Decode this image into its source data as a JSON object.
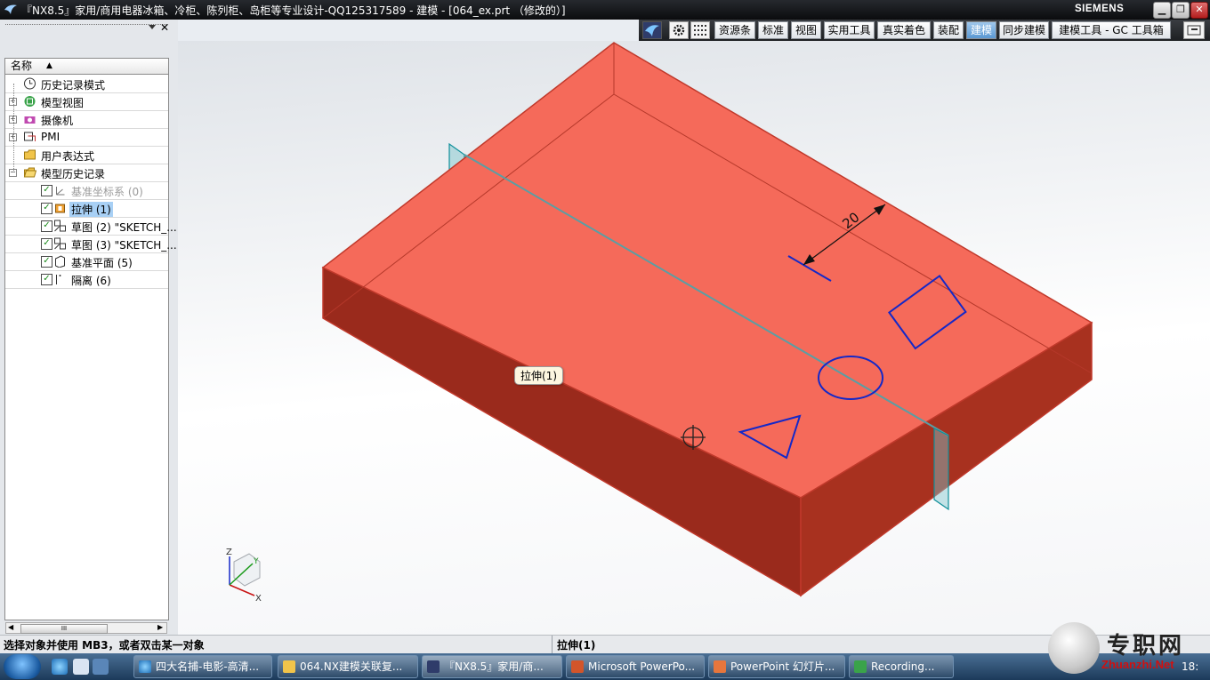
{
  "window": {
    "title": "『NX8.5』家用/商用电器冰箱、冷柜、陈列柜、岛柜等专业设计-QQ125317589 - 建模 - [064_ex.prt （修改的）]",
    "brand": "SIEMENS",
    "controls": {
      "minimize": "▁",
      "restore": "❐",
      "close": "✕"
    }
  },
  "toolbar": {
    "tabs": [
      {
        "label": "资源条",
        "active": false
      },
      {
        "label": "标准",
        "active": false
      },
      {
        "label": "视图",
        "active": false
      },
      {
        "label": "实用工具",
        "active": false
      },
      {
        "label": "真实着色",
        "active": false
      },
      {
        "label": "装配",
        "active": false
      },
      {
        "label": "建模",
        "active": true
      },
      {
        "label": "同步建模",
        "active": false
      },
      {
        "label": "建模工具 - GC 工具箱",
        "active": false
      }
    ]
  },
  "navigator": {
    "column_header": "名称",
    "sort_arrow": "▲",
    "nodes": [
      {
        "label": "历史记录模式",
        "icon": "clock-icon",
        "expander": "",
        "checked": null,
        "selected": false,
        "greyed": false
      },
      {
        "label": "模型视图",
        "icon": "model-view-icon",
        "expander": "+",
        "checked": null,
        "selected": false,
        "greyed": false
      },
      {
        "label": "摄像机",
        "icon": "camera-icon",
        "expander": "+",
        "checked": null,
        "selected": false,
        "greyed": false
      },
      {
        "label": "PMI",
        "icon": "pmi-icon",
        "expander": "+",
        "checked": null,
        "selected": false,
        "greyed": false
      },
      {
        "label": "用户表达式",
        "icon": "folder-icon",
        "expander": "",
        "checked": null,
        "selected": false,
        "greyed": false
      },
      {
        "label": "模型历史记录",
        "icon": "folder-open-icon",
        "expander": "−",
        "checked": null,
        "selected": false,
        "greyed": false
      },
      {
        "label": "基准坐标系 (0)",
        "icon": "datum-csys-icon",
        "expander": "",
        "checked": true,
        "selected": false,
        "greyed": true
      },
      {
        "label": "拉伸 (1)",
        "icon": "extrude-icon",
        "expander": "",
        "checked": true,
        "selected": true,
        "greyed": false
      },
      {
        "label": "草图 (2) \"SKETCH_...",
        "icon": "sketch-icon",
        "expander": "",
        "checked": true,
        "selected": false,
        "greyed": false
      },
      {
        "label": "草图 (3) \"SKETCH_...",
        "icon": "sketch-icon",
        "expander": "",
        "checked": true,
        "selected": false,
        "greyed": false
      },
      {
        "label": "基准平面 (5)",
        "icon": "datum-plane-icon",
        "expander": "",
        "checked": true,
        "selected": false,
        "greyed": false
      },
      {
        "label": "隔离 (6)",
        "icon": "isolate-icon",
        "expander": "",
        "checked": true,
        "selected": false,
        "greyed": false
      }
    ],
    "scroll_thumb": "III"
  },
  "viewport": {
    "tooltip": "拉伸(1)",
    "dimension_value": "20",
    "triad": {
      "z": "Z",
      "y": "Y",
      "x": "X"
    },
    "colors": {
      "solid_top": "#f56a5a",
      "solid_side": "#9a2a1c",
      "sketch": "#1428c8",
      "datum_plane": "#0f8f9a"
    }
  },
  "statusbar": {
    "prompt": "选择对象并使用 MB3，或者双击某一对象",
    "status": "拉伸(1)"
  },
  "taskbar": {
    "items": [
      {
        "label": "四大名捕-电影-高清...",
        "icon": "ie-icon",
        "active": false
      },
      {
        "label": "064.NX建模关联复...",
        "icon": "folder-icon",
        "active": false
      },
      {
        "label": "『NX8.5』家用/商...",
        "icon": "nx-icon",
        "active": true
      },
      {
        "label": "Microsoft PowerPo...",
        "icon": "powerpoint-icon",
        "active": false
      },
      {
        "label": "PowerPoint 幻灯片...",
        "icon": "slideshow-icon",
        "active": false
      },
      {
        "label": "Recording...",
        "icon": "recording-icon",
        "active": false
      }
    ],
    "clock": "18:"
  },
  "watermark": {
    "title": "专职网",
    "url": "Zhuanzhi.Net"
  }
}
